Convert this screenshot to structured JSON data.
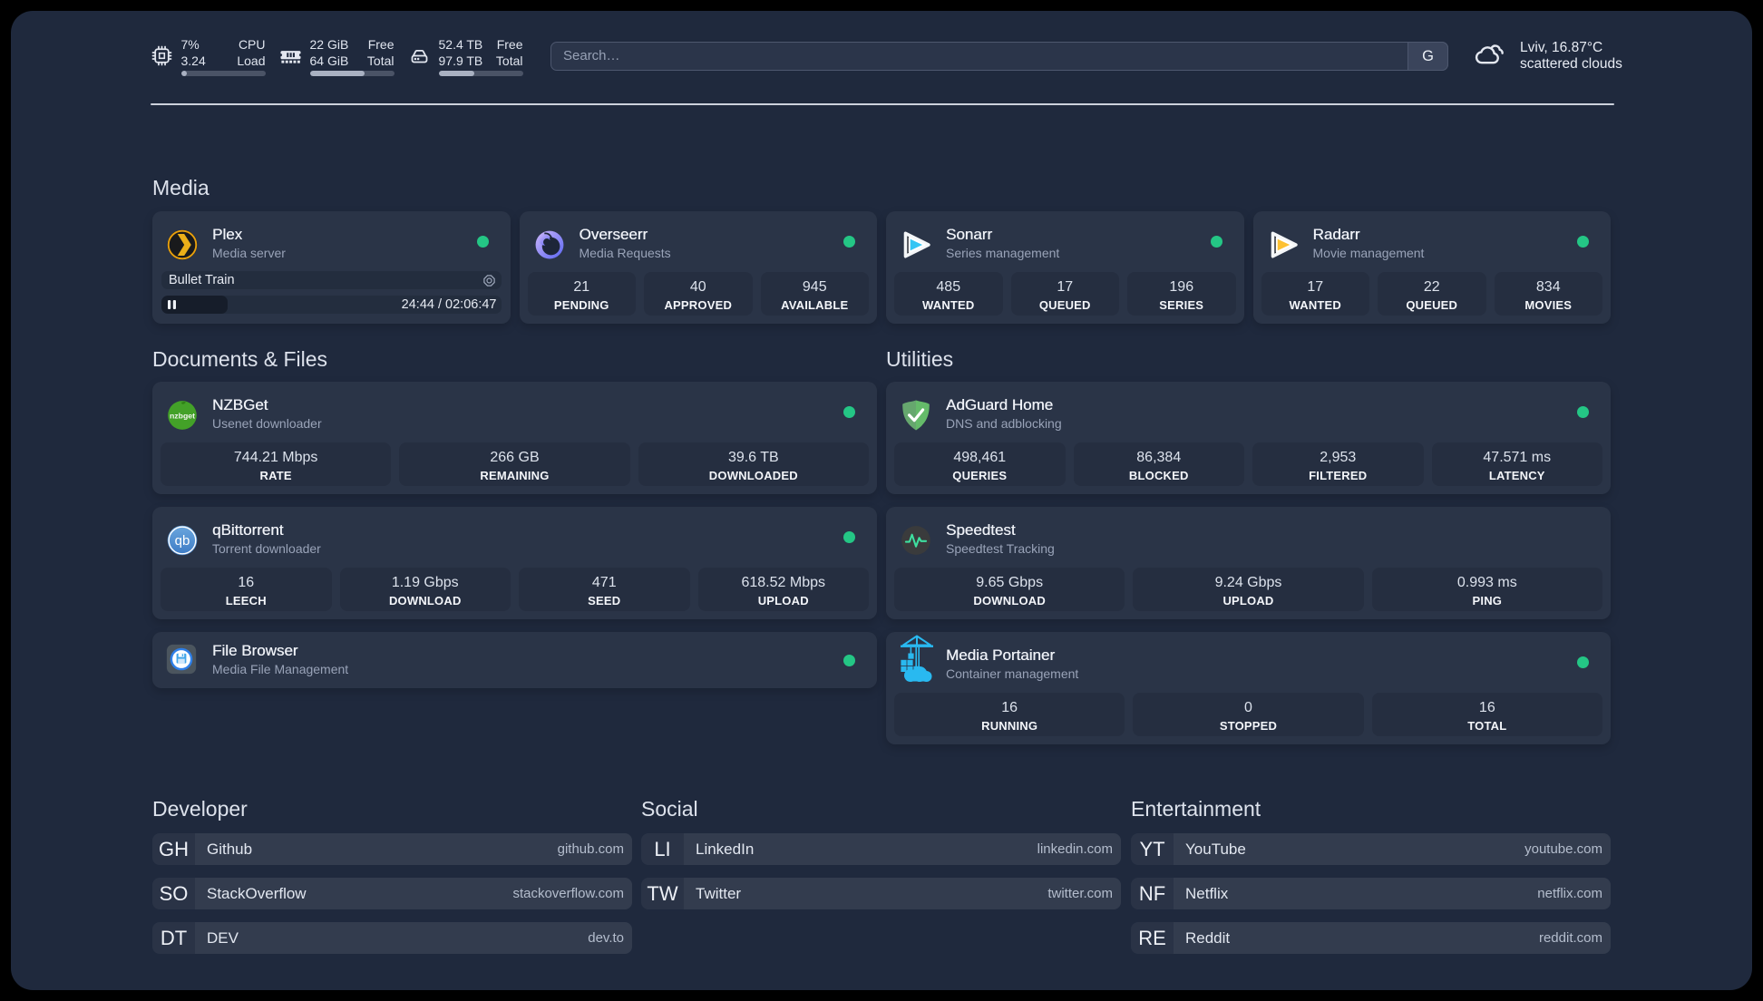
{
  "colors": {
    "background": "#1f293d",
    "card": "#2a3447",
    "accent_green": "#24c685",
    "text_primary": "#eef1f7",
    "text_secondary": "#99a3b8"
  },
  "topbar": {
    "resources": [
      {
        "icon": "cpu-icon",
        "line1": {
          "value": "7%",
          "label": "CPU"
        },
        "line2": {
          "value": "3.24",
          "label": "Load"
        },
        "percent": 7
      },
      {
        "icon": "memory-icon",
        "line1": {
          "value": "22 GiB",
          "label": "Free"
        },
        "line2": {
          "value": "64 GiB",
          "label": "Total"
        },
        "percent": 65
      },
      {
        "icon": "disk-icon",
        "line1": {
          "value": "52.4 TB",
          "label": "Free"
        },
        "line2": {
          "value": "97.9 TB",
          "label": "Total"
        },
        "percent": 42.5
      }
    ],
    "search": {
      "placeholder": "Search…",
      "button": "G"
    },
    "weather": {
      "line1": "Lviv, 16.87°C",
      "line2": "scattered clouds"
    }
  },
  "sections": {
    "media": {
      "title": "Media"
    },
    "documents": {
      "title": "Documents & Files"
    },
    "utilities": {
      "title": "Utilities"
    },
    "developer": {
      "title": "Developer"
    },
    "social": {
      "title": "Social"
    },
    "entertainment": {
      "title": "Entertainment"
    }
  },
  "services": {
    "plex": {
      "name": "Plex",
      "desc": "Media server",
      "status": "online",
      "stream": {
        "title": "Bullet Train",
        "time": "24:44 / 02:06:47",
        "progress": 19.6
      }
    },
    "overseerr": {
      "name": "Overseerr",
      "desc": "Media Requests",
      "status": "online",
      "stats": [
        {
          "value": "21",
          "label": "PENDING"
        },
        {
          "value": "40",
          "label": "APPROVED"
        },
        {
          "value": "945",
          "label": "AVAILABLE"
        }
      ]
    },
    "sonarr": {
      "name": "Sonarr",
      "desc": "Series management",
      "status": "online",
      "stats": [
        {
          "value": "485",
          "label": "WANTED"
        },
        {
          "value": "17",
          "label": "QUEUED"
        },
        {
          "value": "196",
          "label": "SERIES"
        }
      ]
    },
    "radarr": {
      "name": "Radarr",
      "desc": "Movie management",
      "status": "online",
      "stats": [
        {
          "value": "17",
          "label": "WANTED"
        },
        {
          "value": "22",
          "label": "QUEUED"
        },
        {
          "value": "834",
          "label": "MOVIES"
        }
      ]
    },
    "nzbget": {
      "name": "NZBGet",
      "desc": "Usenet downloader",
      "status": "online",
      "stats": [
        {
          "value": "744.21 Mbps",
          "label": "RATE"
        },
        {
          "value": "266 GB",
          "label": "REMAINING"
        },
        {
          "value": "39.6 TB",
          "label": "DOWNLOADED"
        }
      ],
      "logo_text": "nzbget"
    },
    "qbittorrent": {
      "name": "qBittorrent",
      "desc": "Torrent downloader",
      "status": "online",
      "stats": [
        {
          "value": "16",
          "label": "LEECH"
        },
        {
          "value": "1.19 Gbps",
          "label": "DOWNLOAD"
        },
        {
          "value": "471",
          "label": "SEED"
        },
        {
          "value": "618.52 Mbps",
          "label": "UPLOAD"
        }
      ],
      "logo_text": "qb"
    },
    "filebrowser": {
      "name": "File Browser",
      "desc": "Media File Management",
      "status": "online"
    },
    "adguard": {
      "name": "AdGuard Home",
      "desc": "DNS and adblocking",
      "status": "online",
      "stats": [
        {
          "value": "498,461",
          "label": "QUERIES"
        },
        {
          "value": "86,384",
          "label": "BLOCKED"
        },
        {
          "value": "2,953",
          "label": "FILTERED"
        },
        {
          "value": "47.571 ms",
          "label": "LATENCY"
        }
      ]
    },
    "speedtest": {
      "name": "Speedtest",
      "desc": "Speedtest Tracking",
      "stats": [
        {
          "value": "9.65 Gbps",
          "label": "DOWNLOAD"
        },
        {
          "value": "9.24 Gbps",
          "label": "UPLOAD"
        },
        {
          "value": "0.993 ms",
          "label": "PING"
        }
      ]
    },
    "portainer": {
      "name": "Media Portainer",
      "desc": "Container management",
      "status": "online",
      "stats": [
        {
          "value": "16",
          "label": "RUNNING"
        },
        {
          "value": "0",
          "label": "STOPPED"
        },
        {
          "value": "16",
          "label": "TOTAL"
        }
      ]
    }
  },
  "bookmarks": {
    "developer": [
      {
        "abbr": "GH",
        "name": "Github",
        "domain": "github.com"
      },
      {
        "abbr": "SO",
        "name": "StackOverflow",
        "domain": "stackoverflow.com"
      },
      {
        "abbr": "DT",
        "name": "DEV",
        "domain": "dev.to"
      }
    ],
    "social": [
      {
        "abbr": "LI",
        "name": "LinkedIn",
        "domain": "linkedin.com"
      },
      {
        "abbr": "TW",
        "name": "Twitter",
        "domain": "twitter.com"
      }
    ],
    "entertainment": [
      {
        "abbr": "YT",
        "name": "YouTube",
        "domain": "youtube.com"
      },
      {
        "abbr": "NF",
        "name": "Netflix",
        "domain": "netflix.com"
      },
      {
        "abbr": "RE",
        "name": "Reddit",
        "domain": "reddit.com"
      }
    ]
  }
}
